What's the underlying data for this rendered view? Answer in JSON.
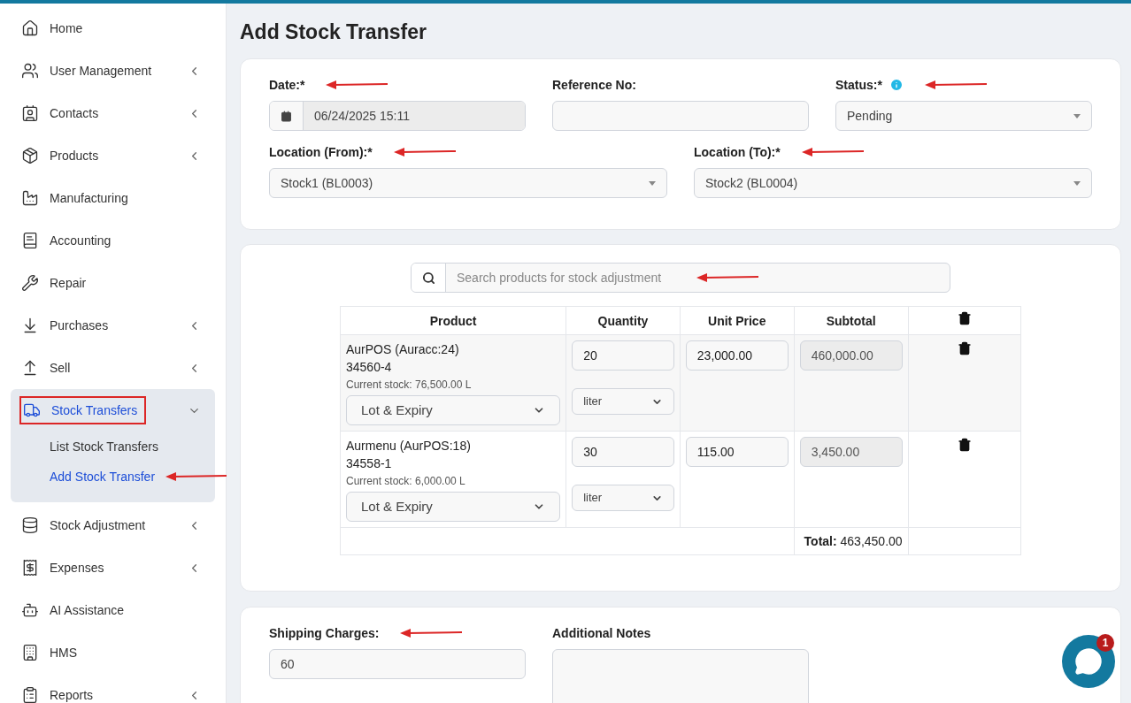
{
  "sidebar": {
    "items": [
      {
        "label": "Home",
        "submenu": false,
        "selected": false,
        "annotated": false
      },
      {
        "label": "User Management",
        "submenu": true,
        "selected": false,
        "annotated": false
      },
      {
        "label": "Contacts",
        "submenu": true,
        "selected": false,
        "annotated": false
      },
      {
        "label": "Products",
        "submenu": true,
        "selected": false,
        "annotated": false
      },
      {
        "label": "Manufacturing",
        "submenu": false,
        "selected": false,
        "annotated": false
      },
      {
        "label": "Accounting",
        "submenu": false,
        "selected": false,
        "annotated": false
      },
      {
        "label": "Repair",
        "submenu": false,
        "selected": false,
        "annotated": false
      },
      {
        "label": "Purchases",
        "submenu": true,
        "selected": false,
        "annotated": false
      },
      {
        "label": "Sell",
        "submenu": true,
        "selected": false,
        "annotated": false
      },
      {
        "label": "Stock Transfers",
        "submenu": true,
        "expanded": true,
        "selected": true,
        "annotated": true,
        "children": [
          {
            "label": "List Stock Transfers",
            "selected": false,
            "annotated": false
          },
          {
            "label": "Add Stock Transfer",
            "selected": true,
            "annotated": true
          }
        ]
      },
      {
        "label": "Stock Adjustment",
        "submenu": true,
        "selected": false,
        "annotated": false
      },
      {
        "label": "Expenses",
        "submenu": true,
        "selected": false,
        "annotated": false
      },
      {
        "label": "AI Assistance",
        "submenu": false,
        "selected": false,
        "annotated": false
      },
      {
        "label": "HMS",
        "submenu": false,
        "selected": false,
        "annotated": false
      },
      {
        "label": "Reports",
        "submenu": true,
        "selected": false,
        "annotated": false
      }
    ]
  },
  "page_title": "Add Stock Transfer",
  "transfer_details": {
    "fields": [
      {
        "kind": "date",
        "label": "Date:*",
        "value": "06/24/2025 15:11",
        "annotated": true
      },
      {
        "kind": "text",
        "label": "Reference No:",
        "annotated": false
      },
      {
        "kind": "select",
        "label": "Status:*",
        "value": "Pending",
        "info": true,
        "annotated": true
      },
      {
        "kind": "select",
        "label": "Location (From):*",
        "value": "Stock1 (BL0003)",
        "annotated": true
      },
      {
        "kind": "select",
        "label": "Location (To):*",
        "value": "Stock2 (BL0004)",
        "annotated": true
      }
    ]
  },
  "products": {
    "search": {
      "placeholder": "Search products for stock adjustment",
      "annotated": true
    },
    "table": {
      "columns": [
        "Product",
        "Quantity",
        "Unit Price",
        "Subtotal"
      ],
      "rows": [
        {
          "name": "AurPOS (Auracc:24)",
          "sku": "34560-4",
          "stock": "Current stock: 76,500.00 L",
          "lot": "Lot & Expiry",
          "quantity": "20",
          "unit": "liter",
          "unit_price": "23,000.00",
          "subtotal": "460,000.00"
        },
        {
          "name": "Aurmenu (AurPOS:18)",
          "sku": "34558-1",
          "stock": "Current stock: 6,000.00 L",
          "lot": "Lot & Expiry",
          "quantity": "30",
          "unit": "liter",
          "unit_price": "115.00",
          "subtotal": "3,450.00"
        }
      ],
      "total_label": "Total:",
      "total": "463,450.00"
    }
  },
  "extras": {
    "fields": [
      {
        "kind": "text",
        "label": "Shipping Charges:",
        "value": "60",
        "annotated": true
      },
      {
        "kind": "textarea",
        "label": "Additional Notes",
        "annotated": false
      }
    ]
  },
  "chat": {
    "badge": "1"
  }
}
